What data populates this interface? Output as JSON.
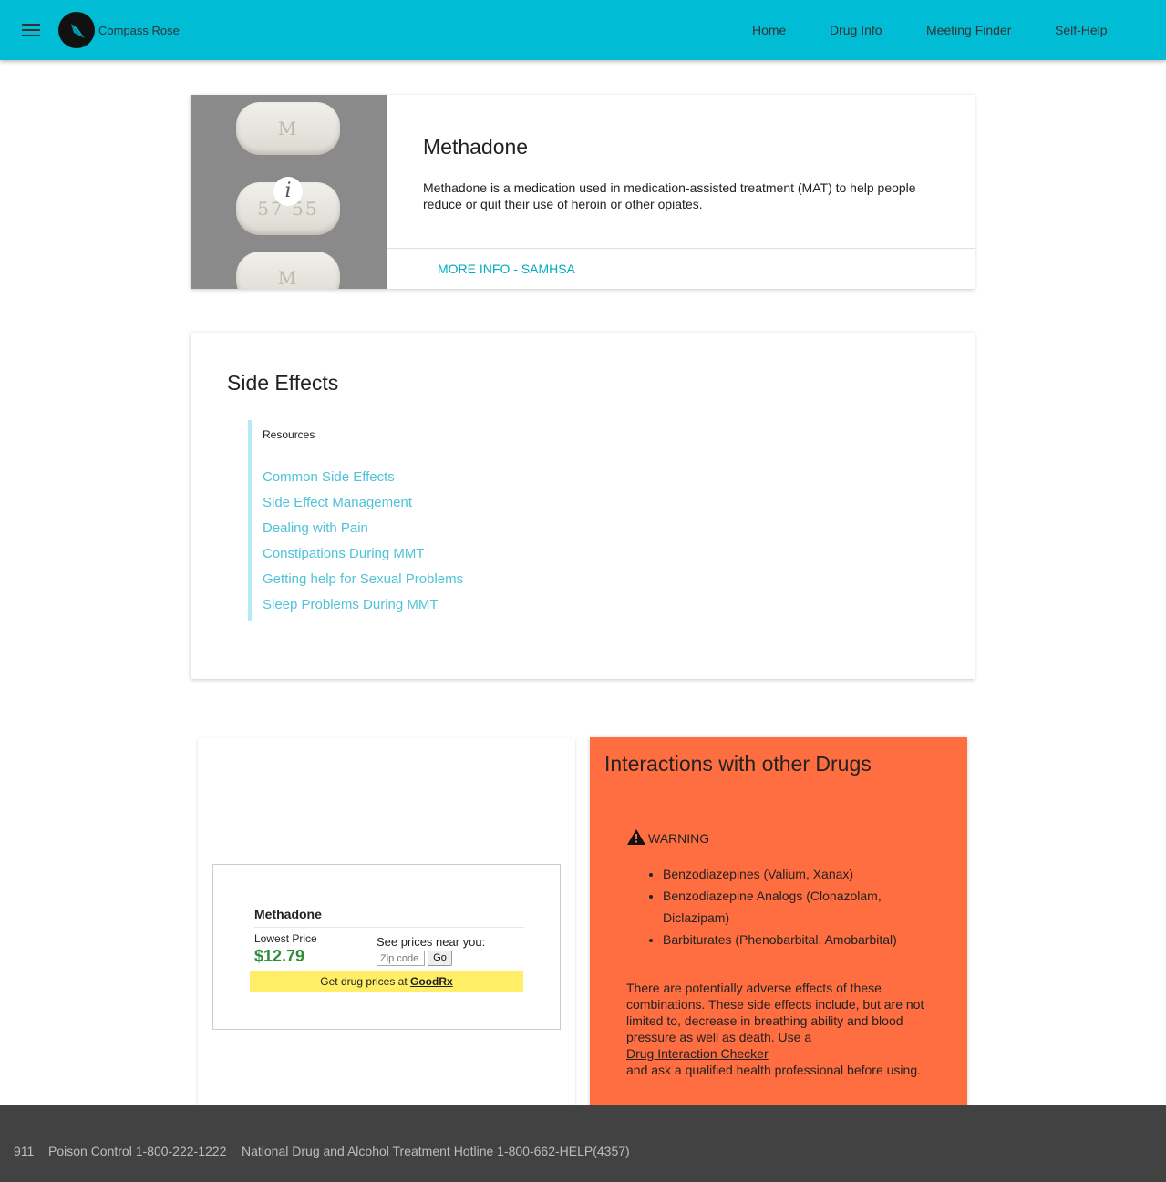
{
  "header": {
    "brand": "Compass Rose",
    "nav": [
      "Home",
      "Drug Info",
      "Meeting Finder",
      "Self-Help"
    ],
    "background": "#00bcd4"
  },
  "drug": {
    "pill_marks": [
      "M",
      "57 55",
      "M"
    ],
    "title": "Methadone",
    "description": "Methadone is a medication used in medication-assisted treatment (MAT) to help people reduce or quit their use of heroin or other opiates.",
    "more_link": "MORE INFO - SAMHSA"
  },
  "side_effects": {
    "title": "Side Effects",
    "resources_label": "Resources",
    "links": [
      "Common Side Effects",
      "Side Effect Management",
      "Dealing with Pain",
      "Constipations During MMT",
      "Getting help for Sexual Problems",
      "Sleep Problems During MMT"
    ]
  },
  "goodrx": {
    "drug_name": "Methadone",
    "lowest_label": "Lowest Price",
    "price": "$12.79",
    "see_prices": "See prices near you:",
    "zip_placeholder": "Zip code",
    "go_label": "Go",
    "banner_text": "Get drug prices at ",
    "banner_link": "GoodRx"
  },
  "interactions": {
    "title": "Interactions with other Drugs",
    "warning": "WARNING",
    "items": [
      "Benzodiazepines (Valium, Xanax)",
      "Benzodiazepine Analogs (Clonazolam, Diclazipam)",
      "Barbiturates (Phenobarbital, Amobarbital)"
    ],
    "paragraph_1": "There are potentially adverse effects of these combinations. These side effects include, but are not limited to, decrease in breathing ability and blood pressure as well as death. Use a",
    "checker_link": "Drug Interaction Checker",
    "paragraph_2": "and ask a qualified health professional before using.",
    "background": "#ff6e40"
  },
  "footer": {
    "items": [
      "911",
      "Poison Control 1-800-222-1222",
      "National Drug and Alcohol Treatment Hotline 1-800-662-HELP(4357)"
    ]
  }
}
